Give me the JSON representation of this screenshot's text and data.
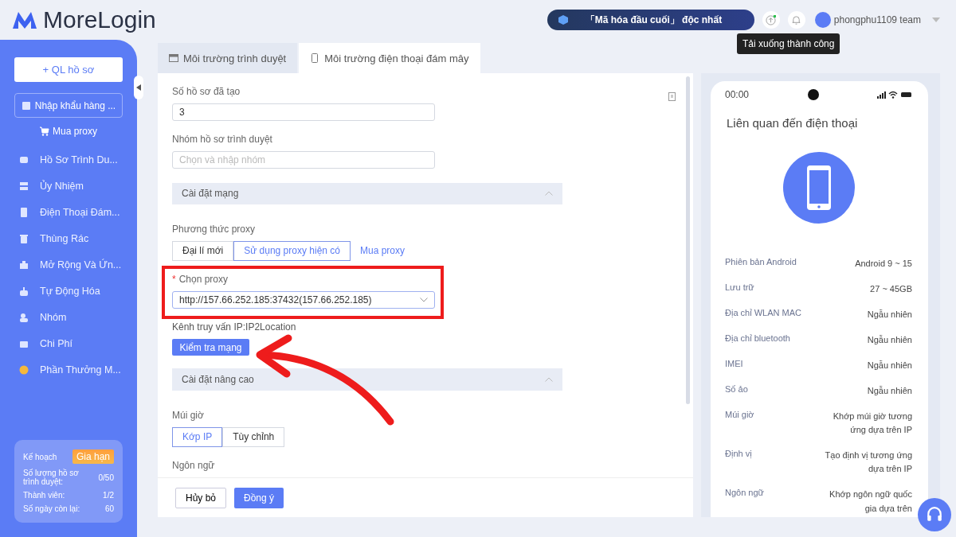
{
  "logo": "MoreLogin",
  "header": {
    "banner": "「Mã hóa đầu cuối」 độc nhất",
    "tooltip": "Tải xuống thành công",
    "user": "phongphu1109 team"
  },
  "sidebar": {
    "new_button": "+ QL hồ sơ",
    "import_button": "Nhập khẩu hàng ...",
    "buy_link": "Mua proxy",
    "items": [
      {
        "label": "Hồ Sơ Trình Du...",
        "selected": false
      },
      {
        "label": "Ủy Nhiệm",
        "selected": false
      },
      {
        "label": "Điện Thoại Đám...",
        "selected": false
      },
      {
        "label": "Thùng Rác",
        "selected": false
      },
      {
        "label": "Mở Rộng Và Ứn...",
        "selected": false
      },
      {
        "label": "Tự Động Hóa",
        "selected": false
      },
      {
        "label": "Nhóm",
        "selected": false
      },
      {
        "label": "Chi Phí",
        "selected": false
      },
      {
        "label": "Phần Thưởng M...",
        "selected": false
      }
    ],
    "plan": {
      "title": "Kế hoạch",
      "renew": "Gia hạn",
      "rows": [
        {
          "label": "Số lượng hồ sơ trình duyệt:",
          "value": "0/50"
        },
        {
          "label": "Thành viên:",
          "value": "1/2"
        },
        {
          "label": "Số ngày còn lại:",
          "value": "60"
        }
      ]
    }
  },
  "tabs": [
    {
      "label": "Môi trường trình duyệt",
      "selected": false
    },
    {
      "label": "Môi trường điện thoại đám mây",
      "selected": true
    }
  ],
  "form": {
    "count_label": "Số hồ sơ đã tạo",
    "count_value": "3",
    "group_label": "Nhóm hồ sơ trình duyệt",
    "group_placeholder": "Chọn và nhập nhóm",
    "network_section": "Cài đặt mạng",
    "proxy_method_label": "Phương thức proxy",
    "proxy_methods": [
      {
        "label": "Đại lí mới",
        "selected": false
      },
      {
        "label": "Sử dụng proxy hiện có",
        "selected": true
      }
    ],
    "buy_proxy_link": "Mua proxy",
    "required_mark": "*",
    "proxy_label": "Chọn proxy",
    "proxy_value": "http://157.66.252.185:37432(157.66.252.185)",
    "query_channel": "Kênh truy vấn IP:IP2Location",
    "check_button": "Kiểm tra mạng",
    "advanced_section": "Cài đặt nâng cao",
    "timezone_label": "Múi giờ",
    "timezone_options": [
      {
        "label": "Kớp IP",
        "selected": true
      },
      {
        "label": "Tùy chỉnh",
        "selected": false
      }
    ],
    "language_label": "Ngôn ngữ",
    "cancel_button": "Hủy bỏ",
    "ok_button": "Đồng ý"
  },
  "phone": {
    "time": "00:00",
    "title": "Liên quan đến điện thoại",
    "specs": [
      {
        "label": "Phiên bản Android",
        "value": "Android 9 ~ 15"
      },
      {
        "label": "Lưu trữ",
        "value": "27 ~ 45GB"
      },
      {
        "label": "Địa chỉ WLAN MAC",
        "value": "Ngẫu nhiên"
      },
      {
        "label": "Địa chỉ bluetooth",
        "value": "Ngẫu nhiên"
      },
      {
        "label": "IMEI",
        "value": "Ngẫu nhiên"
      },
      {
        "label": "Số ảo",
        "value": "Ngẫu nhiên"
      },
      {
        "label": "Múi giờ",
        "value": "Khớp múi giờ tương ứng dựa trên IP"
      },
      {
        "label": "Định vị",
        "value": "Tạo định vị tương ứng dựa trên IP"
      },
      {
        "label": "Ngôn ngữ",
        "value": "Khớp ngôn ngữ quốc gia dựa trên"
      }
    ]
  }
}
